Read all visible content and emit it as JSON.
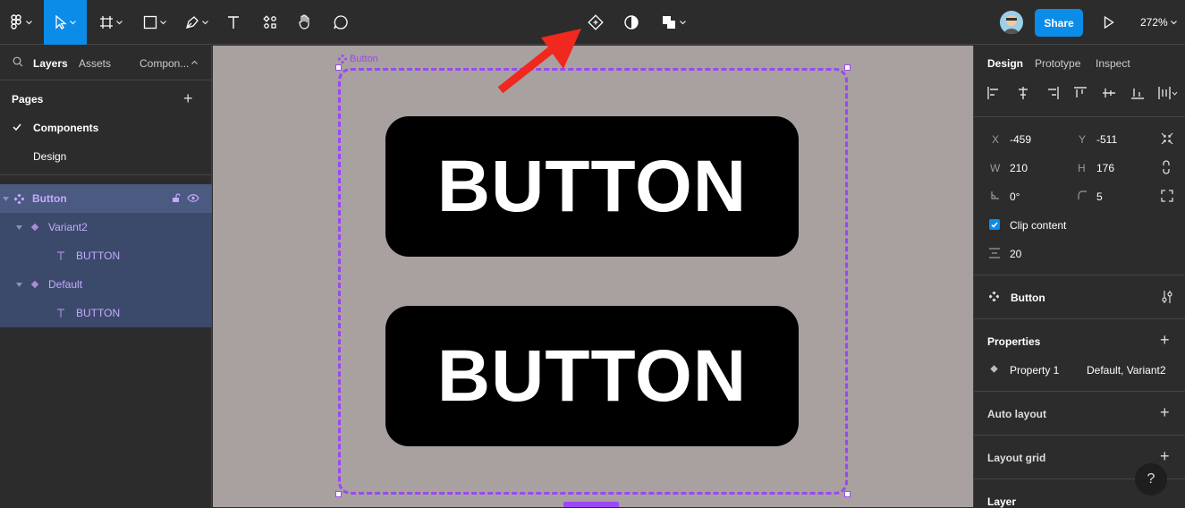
{
  "toolbar": {
    "share_label": "Share",
    "zoom_label": "272%"
  },
  "left_panel": {
    "tabs": [
      "Layers",
      "Assets",
      "Compon..."
    ],
    "pages_title": "Pages",
    "pages": [
      "Components",
      "Design"
    ],
    "layers": [
      {
        "label": "Button",
        "depth": 0
      },
      {
        "label": "Variant2",
        "depth": 1
      },
      {
        "label": "BUTTON",
        "depth": 2
      },
      {
        "label": "Default",
        "depth": 1
      },
      {
        "label": "BUTTON",
        "depth": 2
      }
    ]
  },
  "canvas": {
    "frame_label": "Button",
    "buttons": [
      "BUTTON",
      "BUTTON"
    ]
  },
  "right_panel": {
    "tabs": [
      "Design",
      "Prototype",
      "Inspect"
    ],
    "x_label": "X",
    "x_value": "-459",
    "y_label": "Y",
    "y_value": "-511",
    "w_label": "W",
    "w_value": "210",
    "h_label": "H",
    "h_value": "176",
    "rotation_value": "0°",
    "radius_value": "5",
    "clip_content_label": "Clip content",
    "spacing_value": "20",
    "component_name": "Button",
    "properties_title": "Properties",
    "property_name": "Property 1",
    "property_value": "Default, Variant2",
    "auto_layout_title": "Auto layout",
    "layout_grid_title": "Layout grid",
    "layer_title": "Layer",
    "help_label": "?"
  },
  "colors": {
    "accent": "#0c8ce9",
    "component_purple": "#9a48f5",
    "annotation_arrow": "#f0281e",
    "canvas_bg": "#a9a0a0"
  }
}
